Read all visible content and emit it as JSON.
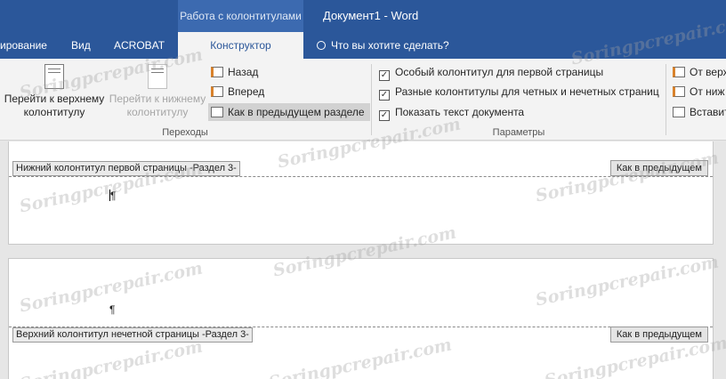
{
  "title_bar": {
    "contextual_tab_group": "Работа с колонтитулами",
    "document_title": "Документ1 - Word"
  },
  "tabs": [
    {
      "label": "ирование"
    },
    {
      "label": "Вид"
    },
    {
      "label": "ACROBAT"
    },
    {
      "label": "Конструктор"
    }
  ],
  "tell_me": "Что вы хотите сделать?",
  "ribbon": {
    "navigation": {
      "goto_header": "Перейти к верхнему колонтитулу",
      "goto_footer": "Перейти к нижнему колонтитулу",
      "previous": "Назад",
      "next": "Вперед",
      "link_to_previous": "Как в предыдущем разделе",
      "group_label": "Переходы"
    },
    "options": {
      "different_first_page": "Особый колонтитул для первой страницы",
      "different_odd_even": "Разные колонтитулы для четных и нечетных страниц",
      "show_document_text": "Показать текст документа",
      "group_label": "Параметры"
    },
    "position": {
      "header_from_top": "От верх",
      "footer_from_bottom": "От ниж",
      "insert_alignment_tab": "Вставит"
    }
  },
  "document": {
    "footer_first_page_tag": "Нижний колонтитул первой страницы -Раздел 3-",
    "header_odd_page_tag": "Верхний колонтитул нечетной страницы -Раздел 3-",
    "same_as_previous": "Как в предыдущем",
    "paragraph_mark": "¶"
  },
  "watermark": "Soringpcrepair.com"
}
